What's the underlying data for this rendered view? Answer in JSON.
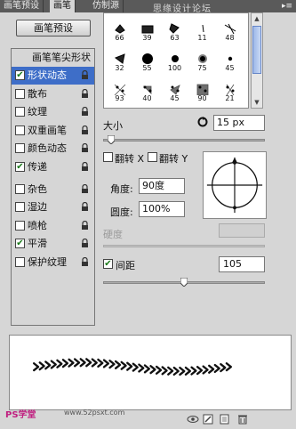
{
  "tabs": [
    {
      "label": "画笔预设",
      "active": false
    },
    {
      "label": "画笔",
      "active": true
    },
    {
      "label": "仿制源",
      "active": false
    }
  ],
  "watermark": "思缘设计论坛",
  "preset_button": "画笔预设",
  "options_header": "画笔笔尖形状",
  "options": [
    {
      "label": "形状动态",
      "checked": true,
      "selected": true
    },
    {
      "label": "散布",
      "checked": false,
      "selected": false
    },
    {
      "label": "纹理",
      "checked": false,
      "selected": false
    },
    {
      "label": "双重画笔",
      "checked": false,
      "selected": false
    },
    {
      "label": "颜色动态",
      "checked": false,
      "selected": false
    },
    {
      "label": "传递",
      "checked": true,
      "selected": false
    },
    {
      "label": "杂色",
      "checked": false,
      "selected": false
    },
    {
      "label": "湿边",
      "checked": false,
      "selected": false
    },
    {
      "label": "喷枪",
      "checked": false,
      "selected": false
    },
    {
      "label": "平滑",
      "checked": true,
      "selected": false
    },
    {
      "label": "保护纹理",
      "checked": false,
      "selected": false
    }
  ],
  "brushes": [
    "66",
    "39",
    "63",
    "11",
    "48",
    "32",
    "55",
    "100",
    "75",
    "45",
    "93",
    "40",
    "45",
    "90",
    "21"
  ],
  "size": {
    "label": "大小",
    "value": "15 px",
    "slider_fraction": 0.05
  },
  "flip_x": {
    "label": "翻转 X",
    "checked": false
  },
  "flip_y": {
    "label": "翻转 Y",
    "checked": false
  },
  "angle": {
    "label": "角度:",
    "value": "90度"
  },
  "roundness": {
    "label": "圆度:",
    "value": "100%"
  },
  "hardness": {
    "label": "硬度",
    "value": ""
  },
  "spacing": {
    "label": "间距",
    "checked": true,
    "value": "105",
    "slider_fraction": 0.5
  },
  "footer": {
    "logo": "PS学堂",
    "site": "www.52psxt.com"
  },
  "colors": {
    "accent": "#3e6ec8",
    "panel": "#d6d6d6",
    "tabbar": "#5a5a5a"
  }
}
